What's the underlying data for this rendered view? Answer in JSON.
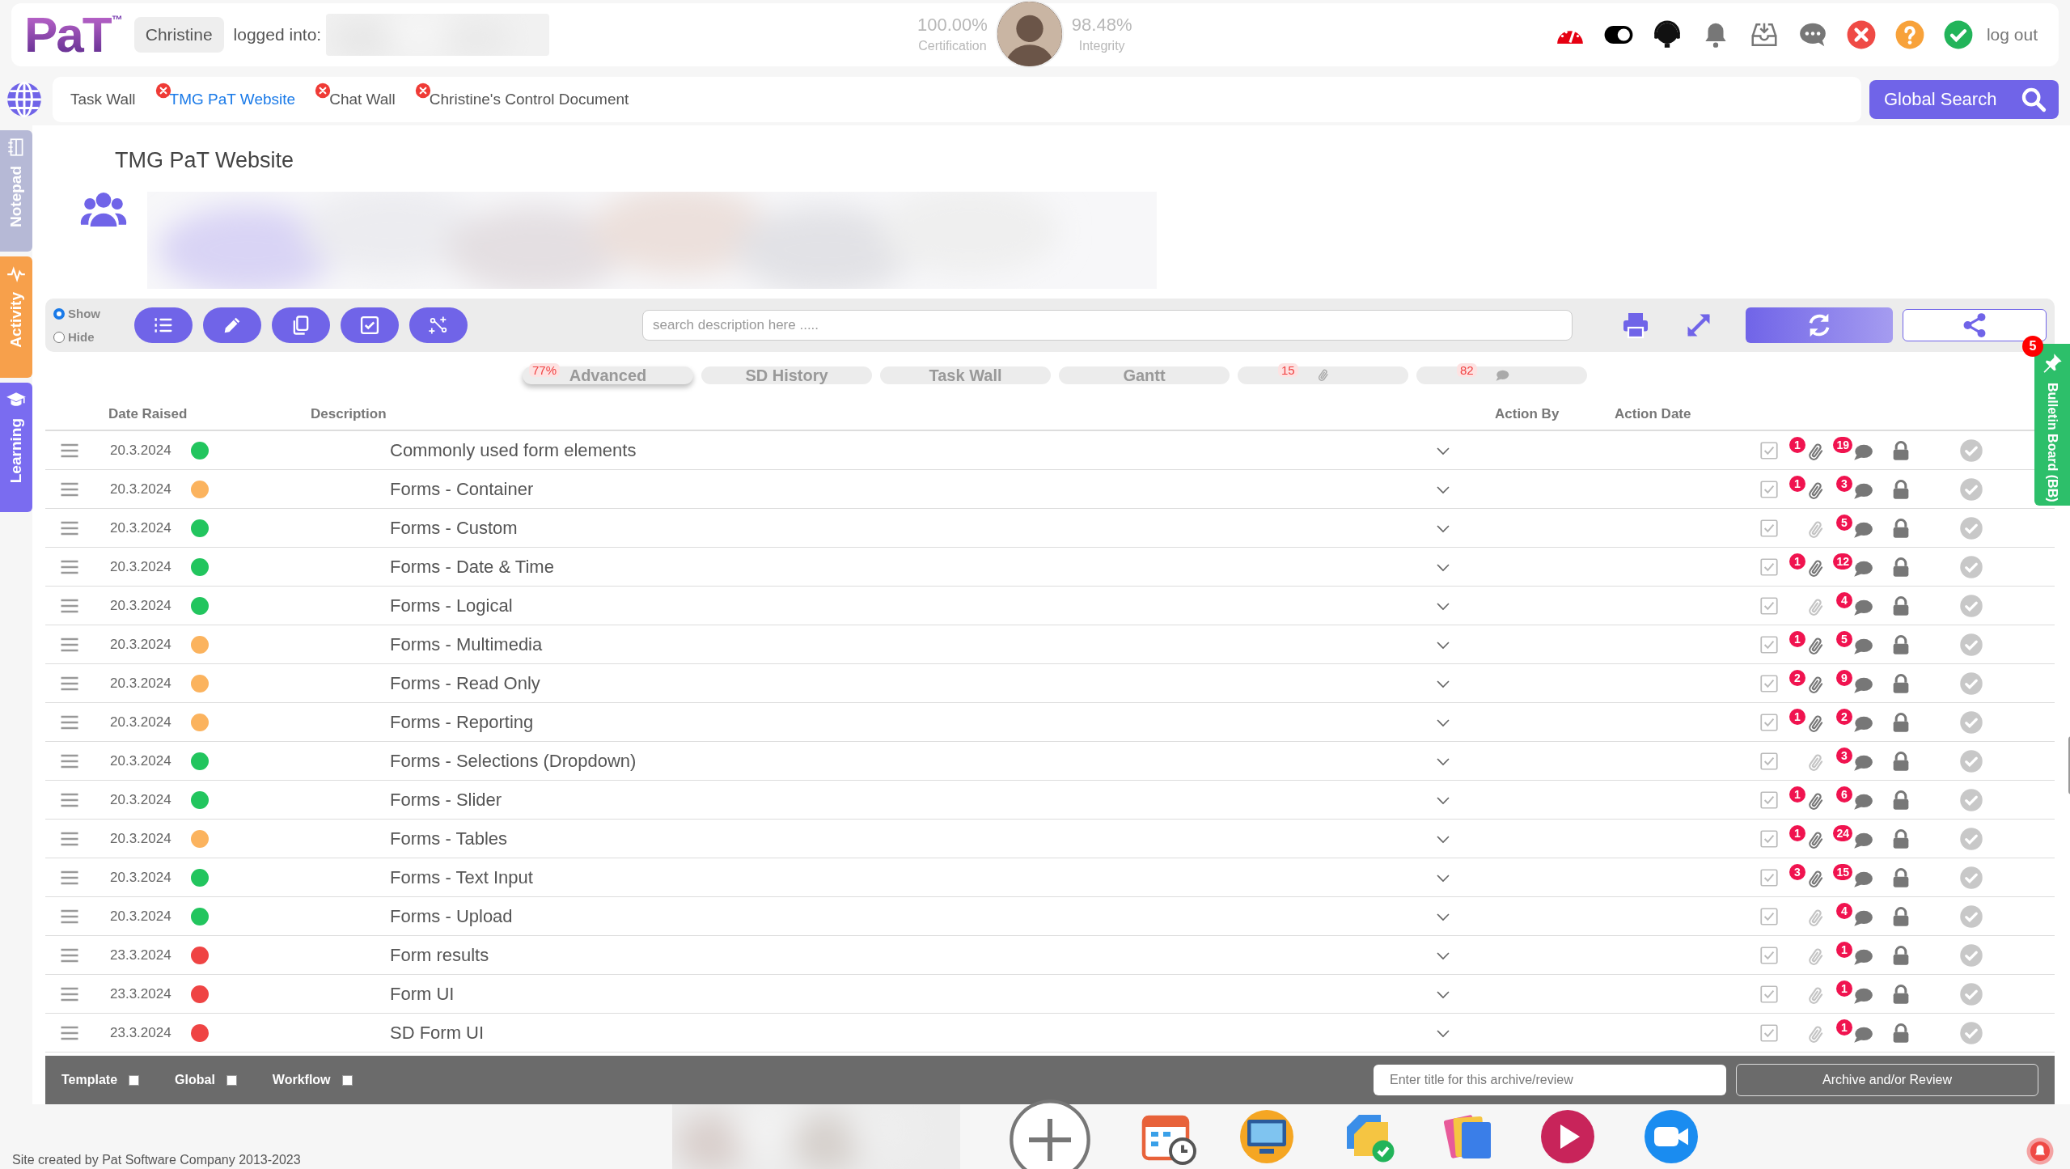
{
  "header": {
    "logo": "PaT",
    "logo_mark": "™",
    "user": "Christine",
    "logged_into": "logged into:",
    "stats": [
      {
        "value": "100.00%",
        "label": "Certification"
      },
      {
        "value": "98.48%",
        "label": "Integrity"
      }
    ],
    "logout": "log out",
    "toggle_on": true
  },
  "tabs": [
    {
      "label": "Task Wall",
      "selected": false,
      "closable": false
    },
    {
      "label": "TMG PaT Website",
      "selected": true,
      "closable": true
    },
    {
      "label": "Chat Wall",
      "selected": false,
      "closable": true
    },
    {
      "label": "Christine's Control Document",
      "selected": false,
      "closable": true
    }
  ],
  "global_search": "Global Search",
  "side_tabs": [
    {
      "label": "Notepad",
      "color": "#b6b9d6"
    },
    {
      "label": "Activity",
      "color": "#f7a04b"
    },
    {
      "label": "Learning",
      "color": "#7a6cf0"
    }
  ],
  "bulletin": {
    "label": "Bulletin Board (BB)",
    "badge": "5"
  },
  "page_title": "TMG PaT Website",
  "visibility": [
    {
      "label": "Show",
      "selected": true
    },
    {
      "label": "Hide",
      "selected": false
    }
  ],
  "search": {
    "placeholder": "search description here ....."
  },
  "view_tabs": [
    {
      "kind": "label",
      "label": "Advanced",
      "badge": "77%",
      "selected": true
    },
    {
      "kind": "label",
      "label": "SD History",
      "selected": false
    },
    {
      "kind": "label",
      "label": "Task Wall",
      "selected": false
    },
    {
      "kind": "label",
      "label": "Gantt",
      "selected": false
    },
    {
      "kind": "attachments",
      "badge": "15",
      "selected": false
    },
    {
      "kind": "comments",
      "badge": "82",
      "selected": false
    }
  ],
  "columns": [
    "Date Raised",
    "Description",
    "Action By",
    "Action Date"
  ],
  "rows": [
    {
      "date": "20.3.2024",
      "color": "#22c55e",
      "description": "Commonly used form elements",
      "attachments": "1",
      "comments": "19"
    },
    {
      "date": "20.3.2024",
      "color": "#fbb35e",
      "description": "Forms - Container",
      "attachments": "1",
      "comments": "3"
    },
    {
      "date": "20.3.2024",
      "color": "#22c55e",
      "description": "Forms - Custom",
      "comments": "5"
    },
    {
      "date": "20.3.2024",
      "color": "#22c55e",
      "description": "Forms - Date & Time",
      "attachments": "1",
      "comments": "12"
    },
    {
      "date": "20.3.2024",
      "color": "#22c55e",
      "description": "Forms - Logical",
      "comments": "4"
    },
    {
      "date": "20.3.2024",
      "color": "#fbb35e",
      "description": "Forms - Multimedia",
      "attachments": "1",
      "comments": "5"
    },
    {
      "date": "20.3.2024",
      "color": "#fbb35e",
      "description": "Forms - Read Only",
      "attachments": "2",
      "comments": "9"
    },
    {
      "date": "20.3.2024",
      "color": "#fbb35e",
      "description": "Forms - Reporting",
      "attachments": "1",
      "comments": "2"
    },
    {
      "date": "20.3.2024",
      "color": "#22c55e",
      "description": "Forms - Selections (Dropdown)",
      "comments": "3"
    },
    {
      "date": "20.3.2024",
      "color": "#22c55e",
      "description": "Forms - Slider",
      "attachments": "1",
      "comments": "6"
    },
    {
      "date": "20.3.2024",
      "color": "#fbb35e",
      "description": "Forms - Tables",
      "attachments": "1",
      "comments": "24"
    },
    {
      "date": "20.3.2024",
      "color": "#22c55e",
      "description": "Forms - Text Input",
      "attachments": "3",
      "comments": "15"
    },
    {
      "date": "20.3.2024",
      "color": "#22c55e",
      "description": "Forms - Upload",
      "comments": "4"
    },
    {
      "date": "23.3.2024",
      "color": "#ef4444",
      "description": "Form results",
      "comments": "1"
    },
    {
      "date": "23.3.2024",
      "color": "#ef4444",
      "description": "Form UI",
      "comments": "1"
    },
    {
      "date": "23.3.2024",
      "color": "#ef4444",
      "description": "SD Form UI",
      "comments": "1"
    }
  ],
  "footer": {
    "options": [
      {
        "label": "Template",
        "checked": false
      },
      {
        "label": "Global",
        "checked": false
      },
      {
        "label": "Workflow",
        "checked": false
      }
    ],
    "title_placeholder": "Enter title for this archive/review",
    "archive_button": "Archive and/or Review"
  },
  "credit": "Site created by Pat Software Company 2013-2023"
}
